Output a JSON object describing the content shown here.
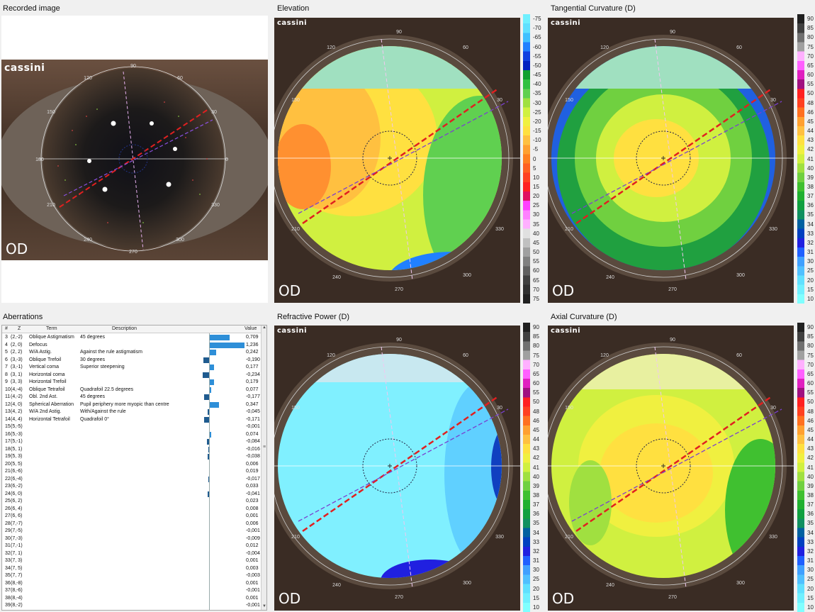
{
  "panels": {
    "recorded": {
      "title": "Recorded image",
      "brand": "cassini",
      "eye": "OD",
      "angles": [
        "90",
        "60",
        "30",
        "0",
        "330",
        "300",
        "270",
        "240",
        "210",
        "180",
        "150",
        "120"
      ]
    },
    "elevation": {
      "title": "Elevation",
      "brand": "cassini",
      "eye": "OD"
    },
    "tangential": {
      "title": "Tangential Curvature (D)",
      "brand": "cassini",
      "eye": "OD"
    },
    "refractive": {
      "title": "Refractive Power (D)",
      "brand": "cassini",
      "eye": "OD"
    },
    "axial": {
      "title": "Axial Curvature (D)",
      "brand": "cassini",
      "eye": "OD"
    },
    "aberrations": {
      "title": "Aberrations"
    }
  },
  "map_angles": [
    "90",
    "60",
    "30",
    "330",
    "300",
    "270",
    "240",
    "210",
    "150",
    "120"
  ],
  "scales": {
    "elevation": [
      "-75",
      "-70",
      "-65",
      "-60",
      "-55",
      "-50",
      "-45",
      "-40",
      "-35",
      "-30",
      "-25",
      "-20",
      "-15",
      "-10",
      "-5",
      "0",
      "5",
      "10",
      "15",
      "20",
      "25",
      "30",
      "35",
      "40",
      "45",
      "50",
      "55",
      "60",
      "65",
      "70",
      "75"
    ],
    "curvature": [
      "90",
      "85",
      "80",
      "75",
      "70",
      "65",
      "60",
      "55",
      "50",
      "48",
      "46",
      "45",
      "44",
      "43",
      "42",
      "41",
      "40",
      "39",
      "38",
      "37",
      "36",
      "35",
      "34",
      "33",
      "32",
      "31",
      "30",
      "25",
      "20",
      "15",
      "10"
    ]
  },
  "table": {
    "headers": {
      "num": "#",
      "z": "Z",
      "term": "Term",
      "desc": "Description",
      "value": "Value"
    },
    "rows": [
      {
        "n": "3",
        "z": "(2,-2)",
        "term": "Oblique Astigmatism",
        "desc": "45 degrees",
        "value": "0,709",
        "v": 0.709
      },
      {
        "n": "4",
        "z": "(2, 0)",
        "term": "Defocus",
        "desc": "",
        "value": "1,236",
        "v": 1.236
      },
      {
        "n": "5",
        "z": "(2, 2)",
        "term": "W/A Astig.",
        "desc": "Against the rule astigmatism",
        "value": "0,242",
        "v": 0.242
      },
      {
        "n": "6",
        "z": "(3,-3)",
        "term": "Oblique Trefoil",
        "desc": "30 degrees",
        "value": "-0,190",
        "v": -0.19
      },
      {
        "n": "7",
        "z": "(3,-1)",
        "term": "Vertical coma",
        "desc": "Superior steepening",
        "value": "0,177",
        "v": 0.177
      },
      {
        "n": "8",
        "z": "(3, 1)",
        "term": "Horizontal coma",
        "desc": "",
        "value": "-0,234",
        "v": -0.234
      },
      {
        "n": "9",
        "z": "(3, 3)",
        "term": "Horizontal Trefoil",
        "desc": "",
        "value": "0,179",
        "v": 0.179
      },
      {
        "n": "10",
        "z": "(4,-4)",
        "term": "Oblique Tetrafoil",
        "desc": "Quadrafoil 22.5 degrees",
        "value": "0,077",
        "v": 0.077
      },
      {
        "n": "11",
        "z": "(4,-2)",
        "term": "Obl. 2nd Ast.",
        "desc": "45 degrees",
        "value": "-0,177",
        "v": -0.177
      },
      {
        "n": "12",
        "z": "(4, 0)",
        "term": "Spherical Aberration",
        "desc": "Pupil periphery more myopic than centre",
        "value": "0,347",
        "v": 0.347
      },
      {
        "n": "13",
        "z": "(4, 2)",
        "term": "W/A 2nd Astig.",
        "desc": "With/Against the rule",
        "value": "-0,045",
        "v": -0.045
      },
      {
        "n": "14",
        "z": "(4, 4)",
        "term": "Horizontal Tetrafoil",
        "desc": "Quadrafoil 0°",
        "value": "-0,171",
        "v": -0.171
      },
      {
        "n": "15",
        "z": "(5,-5)",
        "term": "",
        "desc": "",
        "value": "-0,001",
        "v": -0.001
      },
      {
        "n": "16",
        "z": "(5,-3)",
        "term": "",
        "desc": "",
        "value": "0,074",
        "v": 0.074
      },
      {
        "n": "17",
        "z": "(5,-1)",
        "term": "",
        "desc": "",
        "value": "-0,084",
        "v": -0.084
      },
      {
        "n": "18",
        "z": "(5, 1)",
        "term": "",
        "desc": "",
        "value": "-0,016",
        "v": -0.016
      },
      {
        "n": "19",
        "z": "(5, 3)",
        "term": "",
        "desc": "",
        "value": "-0,038",
        "v": -0.038
      },
      {
        "n": "20",
        "z": "(5, 5)",
        "term": "",
        "desc": "",
        "value": "0,006",
        "v": 0.006
      },
      {
        "n": "21",
        "z": "(6,-6)",
        "term": "",
        "desc": "",
        "value": "0,019",
        "v": 0.019
      },
      {
        "n": "22",
        "z": "(6,-4)",
        "term": "",
        "desc": "",
        "value": "-0,017",
        "v": -0.017
      },
      {
        "n": "23",
        "z": "(6,-2)",
        "term": "",
        "desc": "",
        "value": "0,033",
        "v": 0.033
      },
      {
        "n": "24",
        "z": "(6, 0)",
        "term": "",
        "desc": "",
        "value": "-0,041",
        "v": -0.041
      },
      {
        "n": "25",
        "z": "(6, 2)",
        "term": "",
        "desc": "",
        "value": "0,023",
        "v": 0.023
      },
      {
        "n": "26",
        "z": "(6, 4)",
        "term": "",
        "desc": "",
        "value": "0,008",
        "v": 0.008
      },
      {
        "n": "27",
        "z": "(6, 6)",
        "term": "",
        "desc": "",
        "value": "0,001",
        "v": 0.001
      },
      {
        "n": "28",
        "z": "(7,-7)",
        "term": "",
        "desc": "",
        "value": "0,006",
        "v": 0.006
      },
      {
        "n": "29",
        "z": "(7,-5)",
        "term": "",
        "desc": "",
        "value": "-0,001",
        "v": -0.001
      },
      {
        "n": "30",
        "z": "(7,-3)",
        "term": "",
        "desc": "",
        "value": "-0,009",
        "v": -0.009
      },
      {
        "n": "31",
        "z": "(7,-1)",
        "term": "",
        "desc": "",
        "value": "0,012",
        "v": 0.012
      },
      {
        "n": "32",
        "z": "(7, 1)",
        "term": "",
        "desc": "",
        "value": "-0,004",
        "v": -0.004
      },
      {
        "n": "33",
        "z": "(7, 3)",
        "term": "",
        "desc": "",
        "value": "0,001",
        "v": 0.001
      },
      {
        "n": "34",
        "z": "(7, 5)",
        "term": "",
        "desc": "",
        "value": "0,003",
        "v": 0.003
      },
      {
        "n": "35",
        "z": "(7, 7)",
        "term": "",
        "desc": "",
        "value": "-0,003",
        "v": -0.003
      },
      {
        "n": "36",
        "z": "(8,-8)",
        "term": "",
        "desc": "",
        "value": "0,001",
        "v": 0.001
      },
      {
        "n": "37",
        "z": "(8,-6)",
        "term": "",
        "desc": "",
        "value": "-0,001",
        "v": -0.001
      },
      {
        "n": "38",
        "z": "(8,-4)",
        "term": "",
        "desc": "",
        "value": "0,001",
        "v": 0.001
      },
      {
        "n": "39",
        "z": "(8,-2)",
        "term": "",
        "desc": "",
        "value": "-0,001",
        "v": -0.001
      },
      {
        "n": "40",
        "z": "(8, 0)",
        "term": "",
        "desc": "",
        "value": "0,002",
        "v": 0.002
      },
      {
        "n": "41",
        "z": "(8, 2)",
        "term": "",
        "desc": "",
        "value": "-0,003",
        "v": -0.003
      }
    ]
  }
}
